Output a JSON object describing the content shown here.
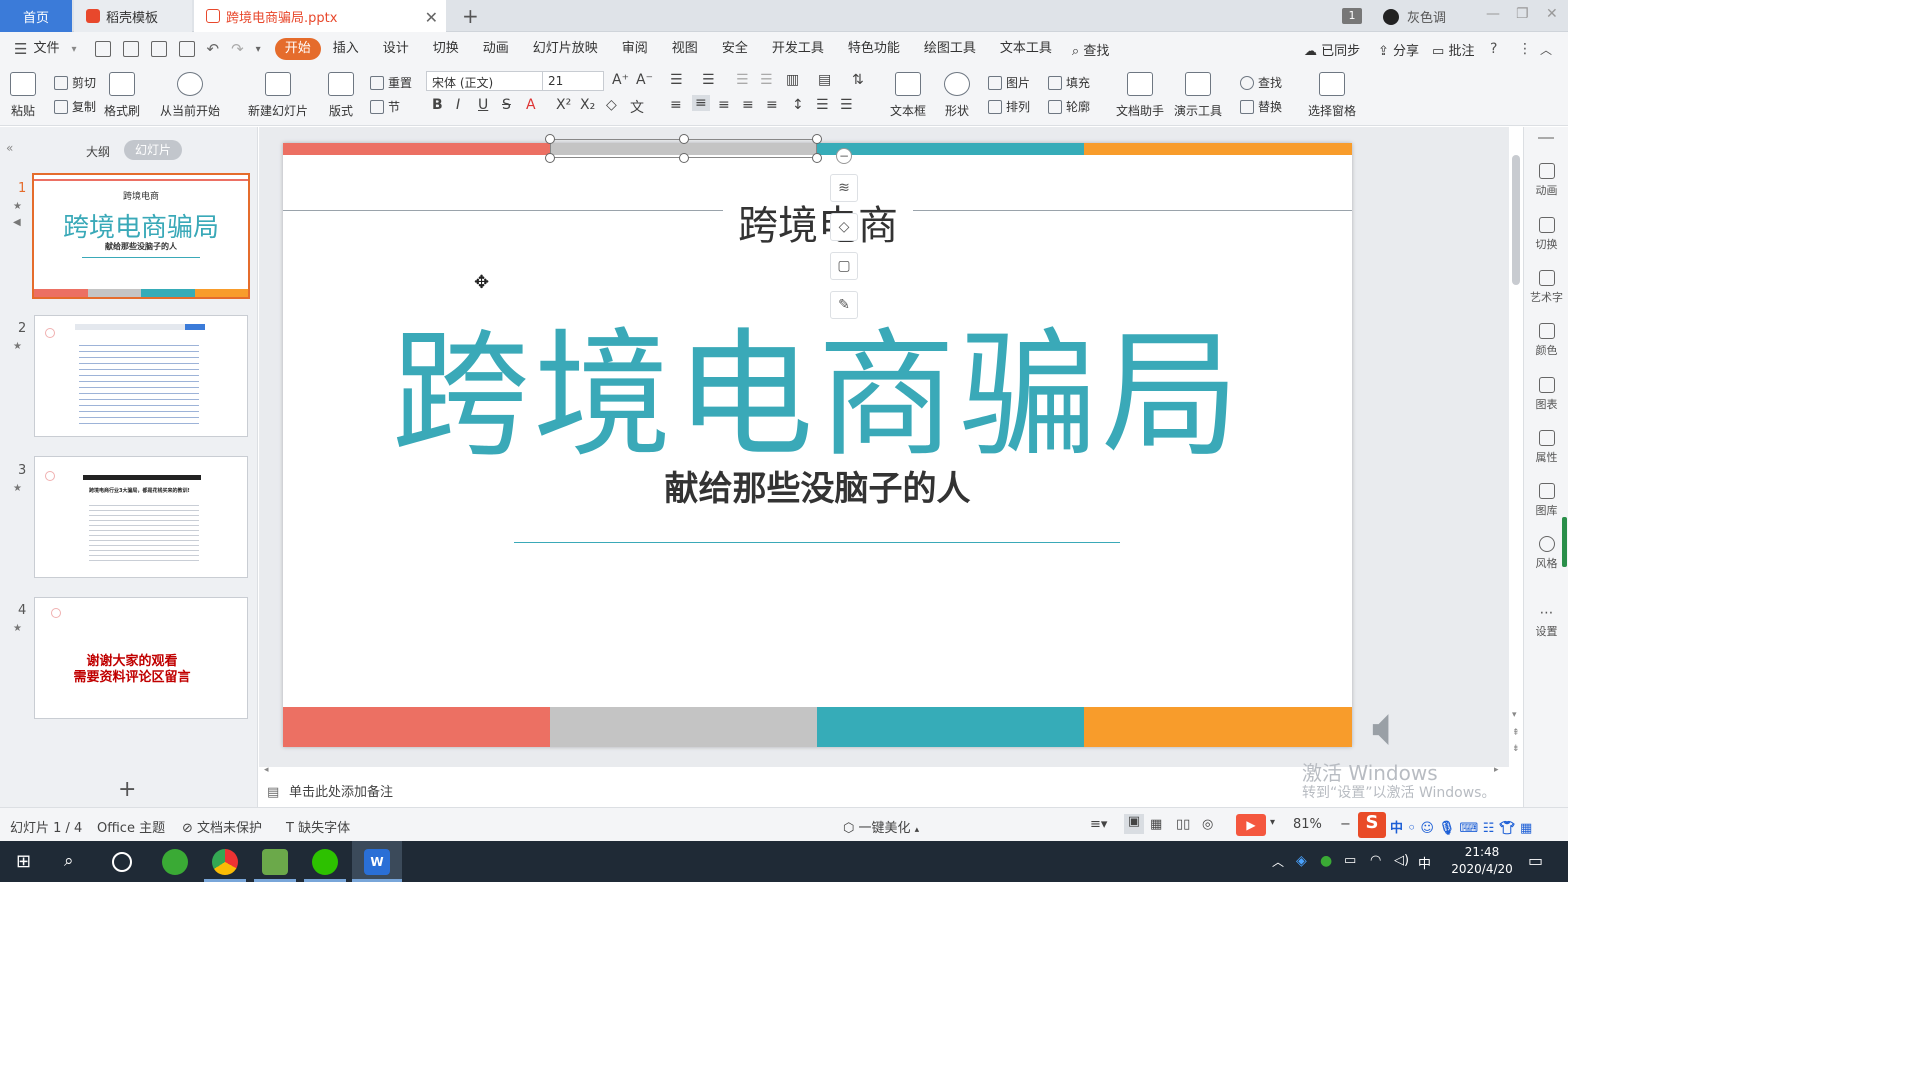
{
  "tabs": {
    "home": "首页",
    "template": "稻壳模板",
    "file": "跨境电商骗局.pptx",
    "count": "1",
    "user": "灰色调"
  },
  "menu": {
    "file": "文件",
    "items": [
      "开始",
      "插入",
      "设计",
      "切换",
      "动画",
      "幻灯片放映",
      "审阅",
      "视图",
      "安全",
      "开发工具",
      "特色功能",
      "绘图工具",
      "文本工具"
    ],
    "search": "查找",
    "sync": "已同步",
    "share": "分享",
    "annotate": "批注"
  },
  "ribbon": {
    "paste": "粘贴",
    "cut": "剪切",
    "copy": "复制",
    "format_painter": "格式刷",
    "from_current": "从当前开始",
    "new_slide": "新建幻灯片",
    "layout": "版式",
    "reset": "重置",
    "section": "节",
    "font_name": "宋体 (正文)",
    "font_size": "21",
    "textbox": "文本框",
    "shape": "形状",
    "picture": "图片",
    "arrange": "排列",
    "fill": "填充",
    "outline": "轮廓",
    "doc_assistant": "文档助手",
    "presentation_tools": "演示工具",
    "find": "查找",
    "replace": "替换",
    "selection_pane": "选择窗格"
  },
  "left_panel": {
    "outline": "大纲",
    "slides": "幻灯片",
    "thumbs": [
      {
        "num": "1",
        "header": "跨境电商",
        "title": "跨境电商骗局",
        "subtitle": "献给那些没脑子的人"
      },
      {
        "num": "2"
      },
      {
        "num": "3",
        "title": "跨境电商行业3大骗局，都是花钱买来的教训!"
      },
      {
        "num": "4",
        "line1": "谢谢大家的观看",
        "line2": "需要资料评论区留言"
      }
    ]
  },
  "slide": {
    "header": "跨境电商",
    "title": "跨境电商骗局",
    "subtitle": "献给那些没脑子的人",
    "colors": {
      "red": "#ec7063",
      "gray": "#c4c4c4",
      "teal": "#36acb8",
      "orange": "#f89c2b"
    }
  },
  "notes": "单击此处添加备注",
  "right_sidebar": [
    "动画",
    "切换",
    "艺术字",
    "颜色",
    "图表",
    "属性",
    "图库",
    "风格",
    "设置"
  ],
  "status": {
    "slide_count": "幻灯片 1 / 4",
    "theme": "Office 主题",
    "protection": "文档未保护",
    "missing_fonts": "缺失字体",
    "beautify": "一键美化",
    "zoom": "81%"
  },
  "watermark": {
    "line1": "激活 Windows",
    "line2": "转到“设置”以激活 Windows。"
  },
  "taskbar": {
    "time": "21:48",
    "date": "2020/4/20",
    "ime": "中"
  }
}
